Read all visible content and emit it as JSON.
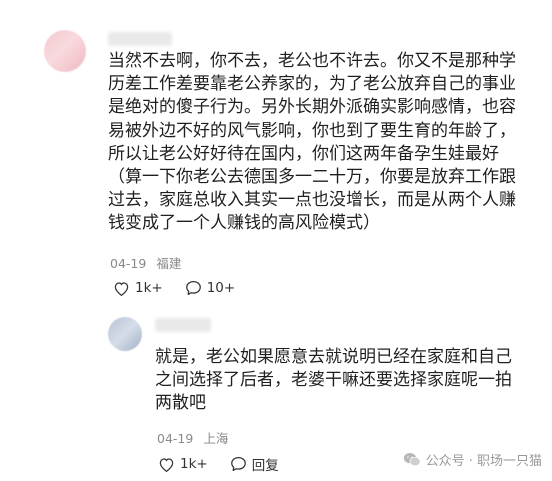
{
  "comment": {
    "text": "当然不去啊，你不去，老公也不许去。你又不是那种学\n历差工作差要靠老公养家的，为了老公放弃自己的事业\n是绝对的傻子行为。另外长期外派确实影响感情，也容\n易被外边不好的风气影响，你也到了要生育的年龄了，\n所以让老公好好待在国内，你们这两年备孕生娃最好\n（算一下你老公去德国多一二十万，你要是放弃工作跟\n过去，家庭总收入其实一点也没增长，而是从两个人赚\n钱变成了一个人赚钱的高风险模式）",
    "date": "04-19",
    "location": "福建",
    "likes": "1k+",
    "replies": "10+"
  },
  "reply": {
    "text": "就是，老公如果愿意去就说明已经在家庭和自己\n之间选择了后者，老婆干嘛还要选择家庭呢一拍\n两散吧",
    "date": "04-19",
    "location": "上海",
    "likes": "1k+",
    "reply_label": "回复"
  },
  "watermark": {
    "text": "公众号 · 职场一只猫"
  },
  "icons": {
    "like": "heart-outline-icon",
    "comment": "speech-bubble-icon",
    "watermark": "wechat-icon"
  }
}
